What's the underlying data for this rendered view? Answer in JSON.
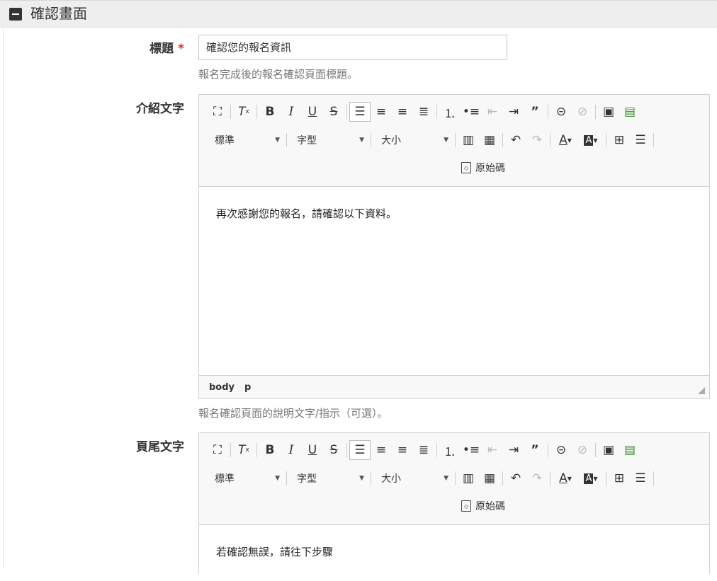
{
  "section": {
    "title": "確認畫面"
  },
  "title_field": {
    "label": "標題",
    "required_mark": "*",
    "value": "確認您的報名資訊",
    "help": "報名完成後的報名確認頁面標題。"
  },
  "intro_field": {
    "label": "介紹文字",
    "content": "再次感謝您的報名，請確認以下資料。",
    "path": [
      "body",
      "p"
    ],
    "help": "報名確認頁面的說明文字/指示（可選）。"
  },
  "footer_field": {
    "label": "頁尾文字",
    "content": "若確認無誤，請往下步驟"
  },
  "toolbar": {
    "format_label": "標準",
    "font_label": "字型",
    "size_label": "大小",
    "source_label": "原始碼",
    "icons": [
      "maximize-icon",
      "remove-format-icon",
      "bold-icon",
      "italic-icon",
      "underline-icon",
      "strikethrough-icon",
      "align-left-icon",
      "align-center-icon",
      "align-right-icon",
      "align-justify-icon",
      "numbered-list-icon",
      "bulleted-list-icon",
      "outdent-icon",
      "indent-icon",
      "blockquote-icon",
      "link-icon",
      "unlink-icon",
      "image-icon",
      "media-icon",
      "paste-word-icon",
      "paste-text-icon",
      "undo-icon",
      "redo-icon",
      "text-color-icon",
      "background-color-icon",
      "table-icon",
      "horizontal-rule-icon",
      "source-icon"
    ]
  }
}
